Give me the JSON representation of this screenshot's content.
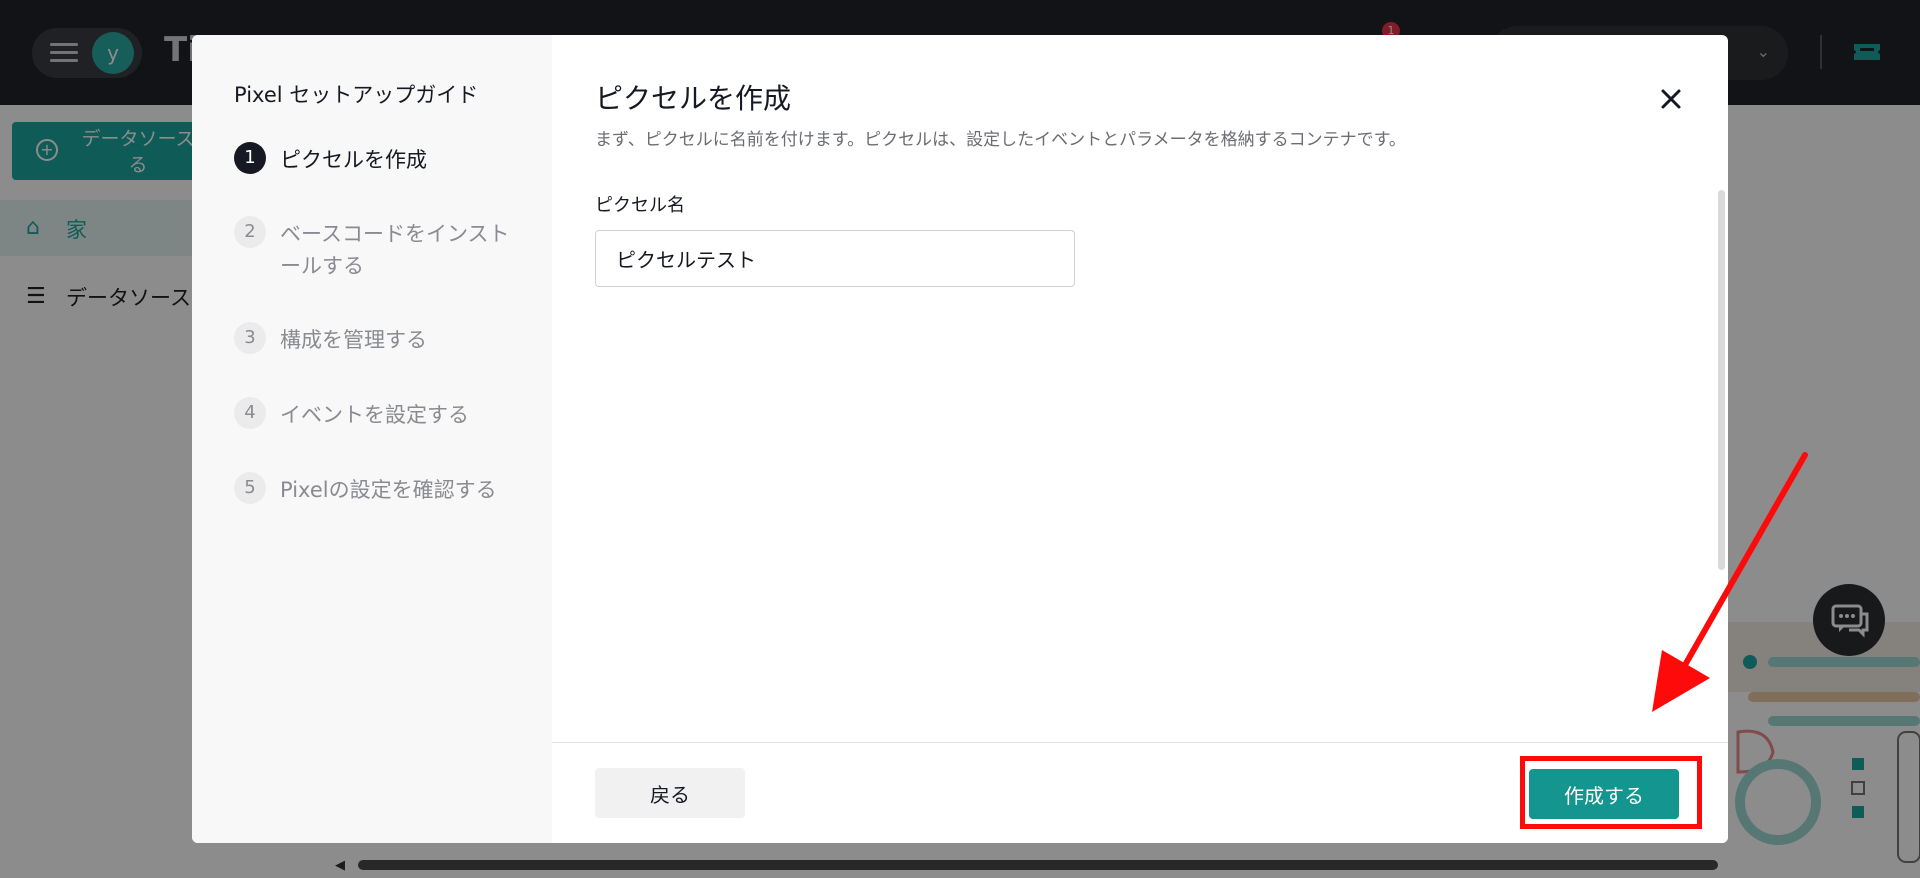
{
  "app": {
    "brand_partial": "Ti",
    "avatar_letter": "y",
    "notification_count": "1"
  },
  "sidebar": {
    "create_source_label": "データソース\nる",
    "items": [
      {
        "label": "家",
        "icon": "home-icon",
        "active": true
      },
      {
        "label": "データソース",
        "icon": "list-icon",
        "active": false
      }
    ]
  },
  "modal": {
    "guide_title": "Pixel セットアップガイド",
    "steps": [
      {
        "number": "1",
        "label": "ピクセルを作成",
        "active": true
      },
      {
        "number": "2",
        "label": "ベースコードをインストールする",
        "active": false
      },
      {
        "number": "3",
        "label": "構成を管理する",
        "active": false
      },
      {
        "number": "4",
        "label": "イベントを設定する",
        "active": false
      },
      {
        "number": "5",
        "label": "Pixelの設定を確認する",
        "active": false
      }
    ],
    "title": "ピクセルを作成",
    "description": "まず、ピクセルに名前を付けます。ピクセルは、設定したイベントとパラメータを格納するコンテナです。",
    "field_label": "ピクセル名",
    "field_value": "ピクセルテスト",
    "back_label": "戻る",
    "create_label": "作成する"
  },
  "colors": {
    "accent": "#14958f",
    "annotation": "#ff0a0a"
  }
}
